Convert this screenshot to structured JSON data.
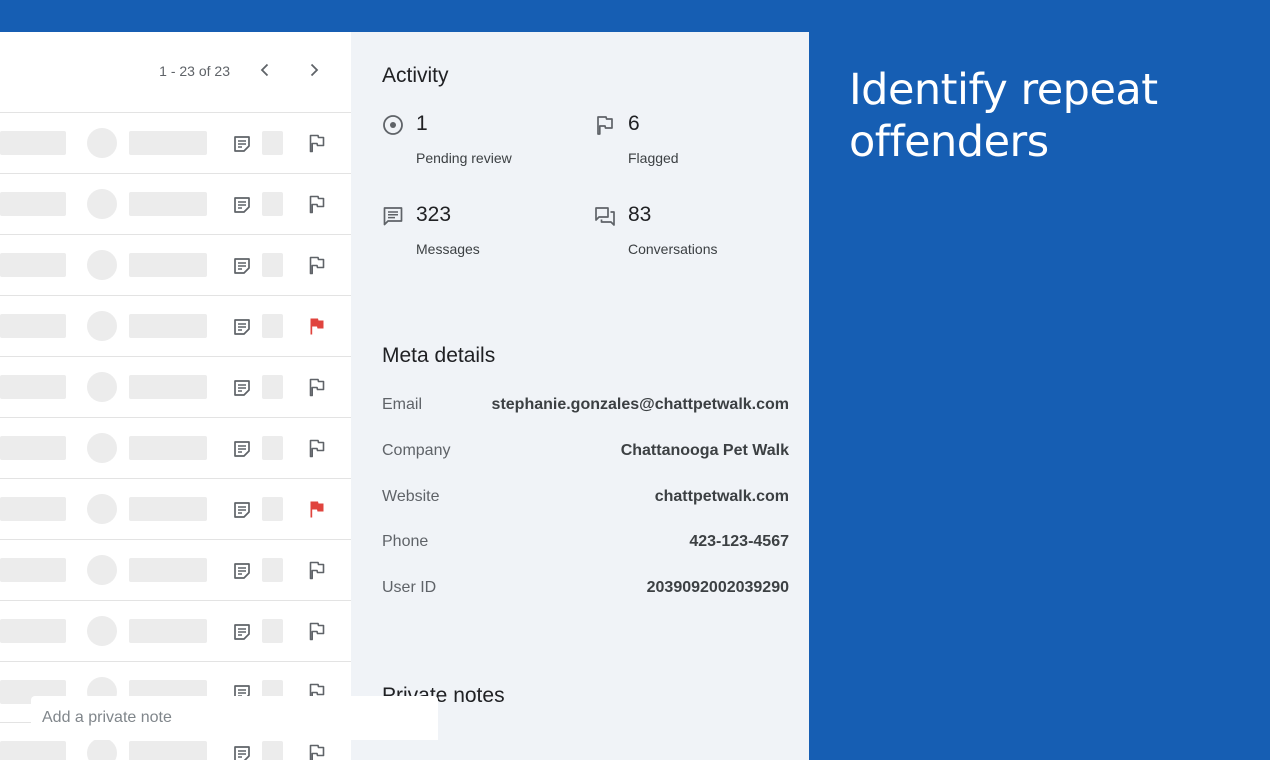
{
  "pagination": {
    "text": "1 - 23 of 23"
  },
  "list": {
    "rows": [
      {
        "flagged": false
      },
      {
        "flagged": false
      },
      {
        "flagged": false
      },
      {
        "flagged": true
      },
      {
        "flagged": false
      },
      {
        "flagged": false
      },
      {
        "flagged": true
      },
      {
        "flagged": false
      },
      {
        "flagged": false
      },
      {
        "flagged": false
      },
      {
        "flagged": false
      }
    ]
  },
  "activity": {
    "title": "Activity",
    "stats": [
      {
        "icon": "pending-review-icon",
        "value": "1",
        "label": "Pending review"
      },
      {
        "icon": "flag-icon",
        "value": "6",
        "label": "Flagged"
      },
      {
        "icon": "messages-icon",
        "value": "323",
        "label": "Messages"
      },
      {
        "icon": "conversations-icon",
        "value": "83",
        "label": "Conversations"
      }
    ]
  },
  "meta": {
    "title": "Meta details",
    "rows": [
      {
        "key": "Email",
        "value": "stephanie.gonzales@chattpetwalk.com"
      },
      {
        "key": "Company",
        "value": "Chattanooga Pet Walk"
      },
      {
        "key": "Website",
        "value": "chattpetwalk.com"
      },
      {
        "key": "Phone",
        "value": "423-123-4567"
      },
      {
        "key": "User ID",
        "value": "2039092002039290"
      }
    ]
  },
  "notes": {
    "title": "Private notes",
    "placeholder": "Add a private note"
  },
  "headline": {
    "text": "Identify repeat offenders"
  },
  "colors": {
    "brand_blue": "#165eb3",
    "flag_red": "#e0443e",
    "icon_gray": "#5f6368",
    "panel_bg": "#f0f3f7"
  }
}
